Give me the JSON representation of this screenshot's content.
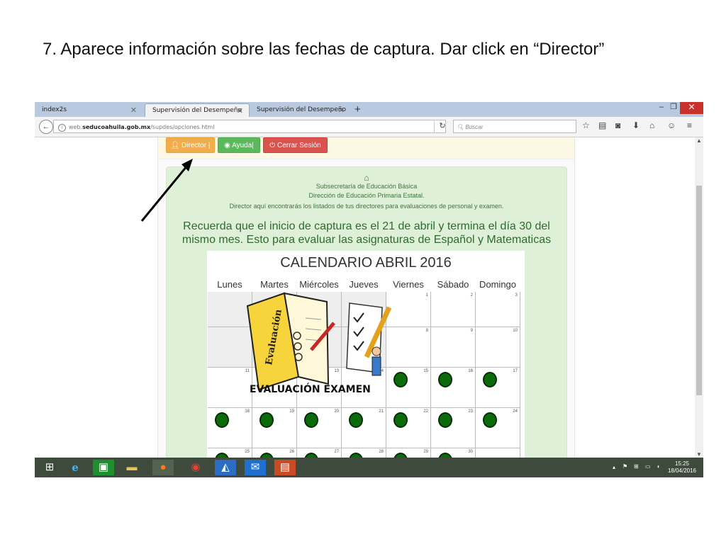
{
  "slide": {
    "title": "7. Aparece información sobre las fechas de captura. Dar click en “Director”"
  },
  "browser": {
    "tabs": [
      {
        "label": "index2s"
      },
      {
        "label": "Supervisión del Desempeño D..."
      },
      {
        "label": "Supervisión del Desempeño D..."
      }
    ],
    "new_tab": "+",
    "url_prefix": "web.",
    "url_domain": "seducoahuila.gob.mx",
    "url_path": "/supdes/opciones.html",
    "search_placeholder": "Buscar",
    "window_min": "–",
    "window_max": "❐",
    "window_close": "✕"
  },
  "page": {
    "buttons": {
      "director": "Director |",
      "ayuda": "Ayuda|",
      "cerrar": "Cerrar Sesión"
    },
    "panel": {
      "line1": "Subsecretaría de Educación Básica",
      "line2": "Dirección de Educación Primaria Estatal.",
      "line3": "Director aquí encontrarás los listados de tus directores para evaluaciones de personal y examen.",
      "message": "Recuerda que el inicio de captura es el 21 de abril y termina el día 30 del mismo mes. Esto para evaluar las asignaturas de Español y Matematicas"
    },
    "calendar": {
      "title": "CALENDARIO ABRIL 2016",
      "days": [
        "Lunes",
        "Martes",
        "Miércoles",
        "Jueves",
        "Viernes",
        "Sábado",
        "Domingo"
      ],
      "rows": [
        [
          "",
          "",
          "",
          "",
          "1",
          "2",
          "3"
        ],
        [
          "",
          "",
          "",
          "",
          "8",
          "9",
          "10"
        ],
        [
          "11",
          "12",
          "13",
          "14",
          "15",
          "16",
          "17"
        ],
        [
          "18",
          "19",
          "20",
          "21",
          "22",
          "23",
          "24"
        ],
        [
          "25",
          "26",
          "27",
          "28",
          "29",
          "30",
          ""
        ]
      ],
      "illustration_book_label": "Evaluación",
      "illustration_caption": "EVALUACIÓN EXAMEN"
    }
  },
  "taskbar": {
    "time": "15:25",
    "date": "18/04/2016"
  },
  "colors": {
    "director_button": "#f0ad4e",
    "ayuda_button": "#5cb85c",
    "cerrar_button": "#d9534f",
    "panel_bg": "#dff0d8",
    "panel_text": "#3c763d",
    "dot": "#0b6b0b"
  }
}
